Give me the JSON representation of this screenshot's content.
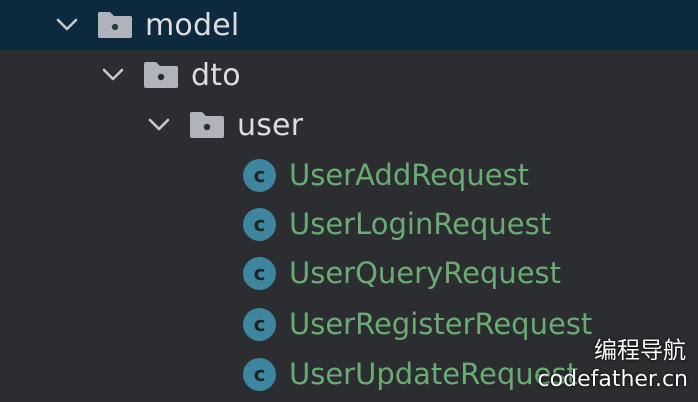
{
  "colors": {
    "background": "#2b2d30",
    "selected_row": "#0d293e",
    "folder_label": "#dcdde0",
    "class_label": "#6aab73",
    "class_icon": "#3e86a0"
  },
  "tree": {
    "model": {
      "label": "model",
      "icon": "folder-icon",
      "expanded": true,
      "selected": true
    },
    "dto": {
      "label": "dto",
      "icon": "folder-icon",
      "expanded": true
    },
    "user": {
      "label": "user",
      "icon": "folder-icon",
      "expanded": true
    },
    "classes": [
      {
        "label": "UserAddRequest",
        "icon_glyph": "c",
        "icon": "class-icon"
      },
      {
        "label": "UserLoginRequest",
        "icon_glyph": "c",
        "icon": "class-icon"
      },
      {
        "label": "UserQueryRequest",
        "icon_glyph": "c",
        "icon": "class-icon"
      },
      {
        "label": "UserRegisterRequest",
        "icon_glyph": "c",
        "icon": "class-icon"
      },
      {
        "label": "UserUpdateRequest",
        "icon_glyph": "c",
        "icon": "class-icon"
      }
    ]
  },
  "watermark": {
    "line1": "编程导航",
    "line2": "codefather.cn"
  }
}
